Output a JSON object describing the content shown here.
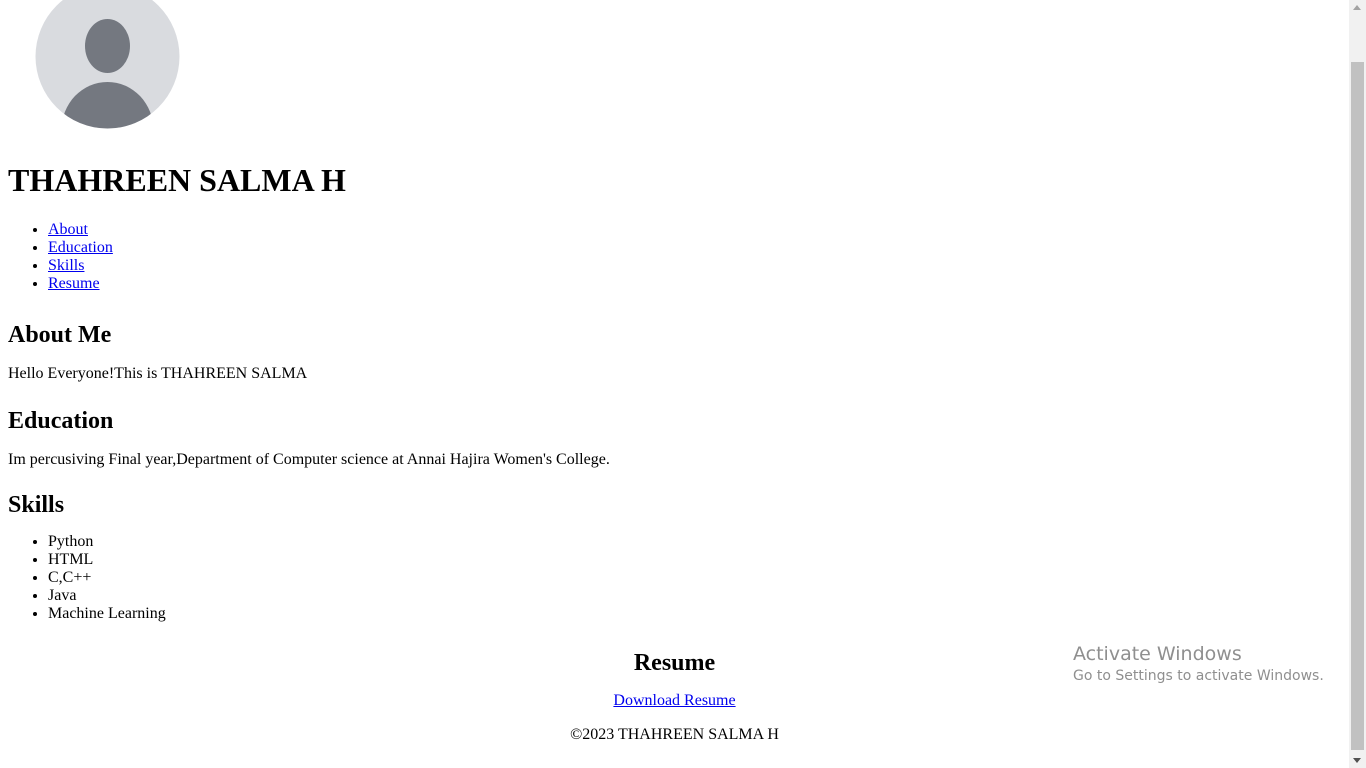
{
  "header": {
    "name": "THAHREEN SALMA H"
  },
  "nav": {
    "items": [
      {
        "label": "About"
      },
      {
        "label": "Education"
      },
      {
        "label": "Skills"
      },
      {
        "label": "Resume"
      }
    ]
  },
  "about": {
    "heading": "About Me",
    "text": "Hello Everyone!This is THAHREEN SALMA"
  },
  "education": {
    "heading": "Education",
    "text": "Im percusiving Final year,Department of Computer science at Annai Hajira Women's College."
  },
  "skills": {
    "heading": "Skills",
    "items": [
      "Python",
      "HTML",
      "C,C++",
      "Java",
      "Machine Learning"
    ]
  },
  "resume": {
    "heading": "Resume",
    "link_label": "Download Resume"
  },
  "footer": {
    "text": "©2023 THAHREEN SALMA H"
  },
  "watermark": {
    "title": "Activate Windows",
    "subtitle": "Go to Settings to activate Windows."
  },
  "icons": {
    "avatar": "person-placeholder-icon"
  },
  "colors": {
    "link": "#0000ee",
    "avatar_bg": "#d9dbdf",
    "avatar_fg": "#747880",
    "scrollbar_track": "#f1f1f1",
    "scrollbar_thumb": "#c1c1c1",
    "watermark": "#8f8f8f"
  }
}
